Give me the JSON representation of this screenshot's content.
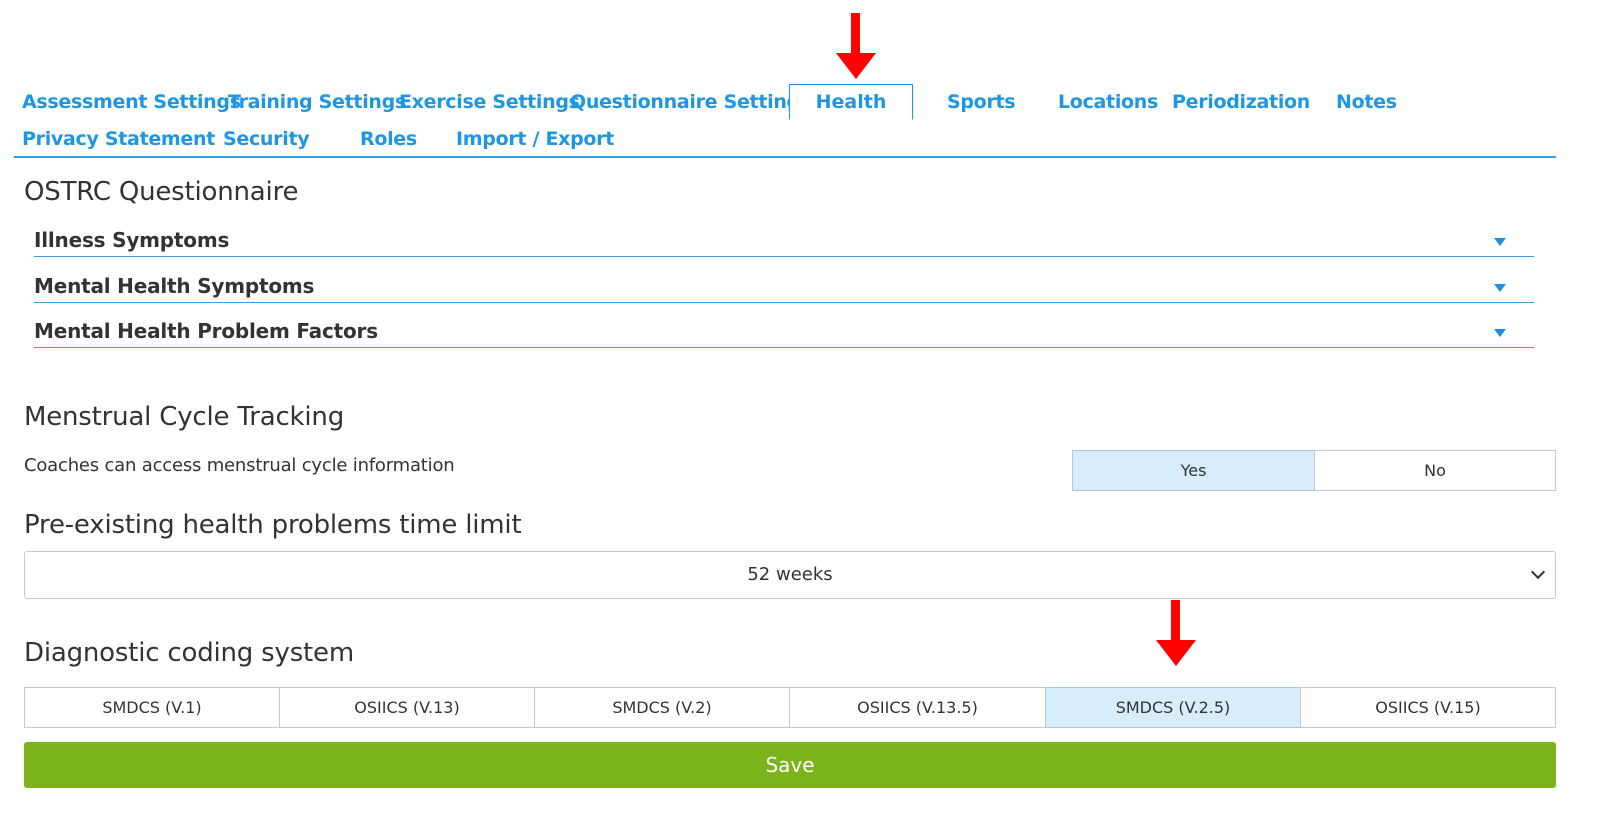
{
  "tabs": {
    "row1": [
      "Assessment Settings",
      "Training Settings",
      "Exercise Settings",
      "Questionnaire Settings",
      "Health",
      "Sports",
      "Locations",
      "Periodization",
      "Notes"
    ],
    "row2": [
      "Privacy Statement",
      "Security",
      "Roles",
      "Import / Export"
    ],
    "active": "Health"
  },
  "ostrc": {
    "title": "OSTRC Questionnaire",
    "items": [
      "Illness Symptoms",
      "Mental Health Symptoms",
      "Mental Health Problem Factors"
    ]
  },
  "menstrual": {
    "title": "Menstrual Cycle Tracking",
    "description": "Coaches can access menstrual cycle information",
    "options": [
      "Yes",
      "No"
    ],
    "selected": "Yes"
  },
  "preexisting": {
    "title": "Pre-existing health problems time limit",
    "value": "52 weeks"
  },
  "diagnostic": {
    "title": "Diagnostic coding system",
    "options": [
      "SMDCS (V.1)",
      "OSIICS (V.13)",
      "SMDCS (V.2)",
      "OSIICS (V.13.5)",
      "SMDCS (V.2.5)",
      "OSIICS (V.15)"
    ],
    "selected": "SMDCS (V.2.5)"
  },
  "save_label": "Save",
  "colors": {
    "link": "#1e96e6",
    "selected": "#d7edfb",
    "save": "#7bb31a",
    "arrow": "#ff0000"
  }
}
